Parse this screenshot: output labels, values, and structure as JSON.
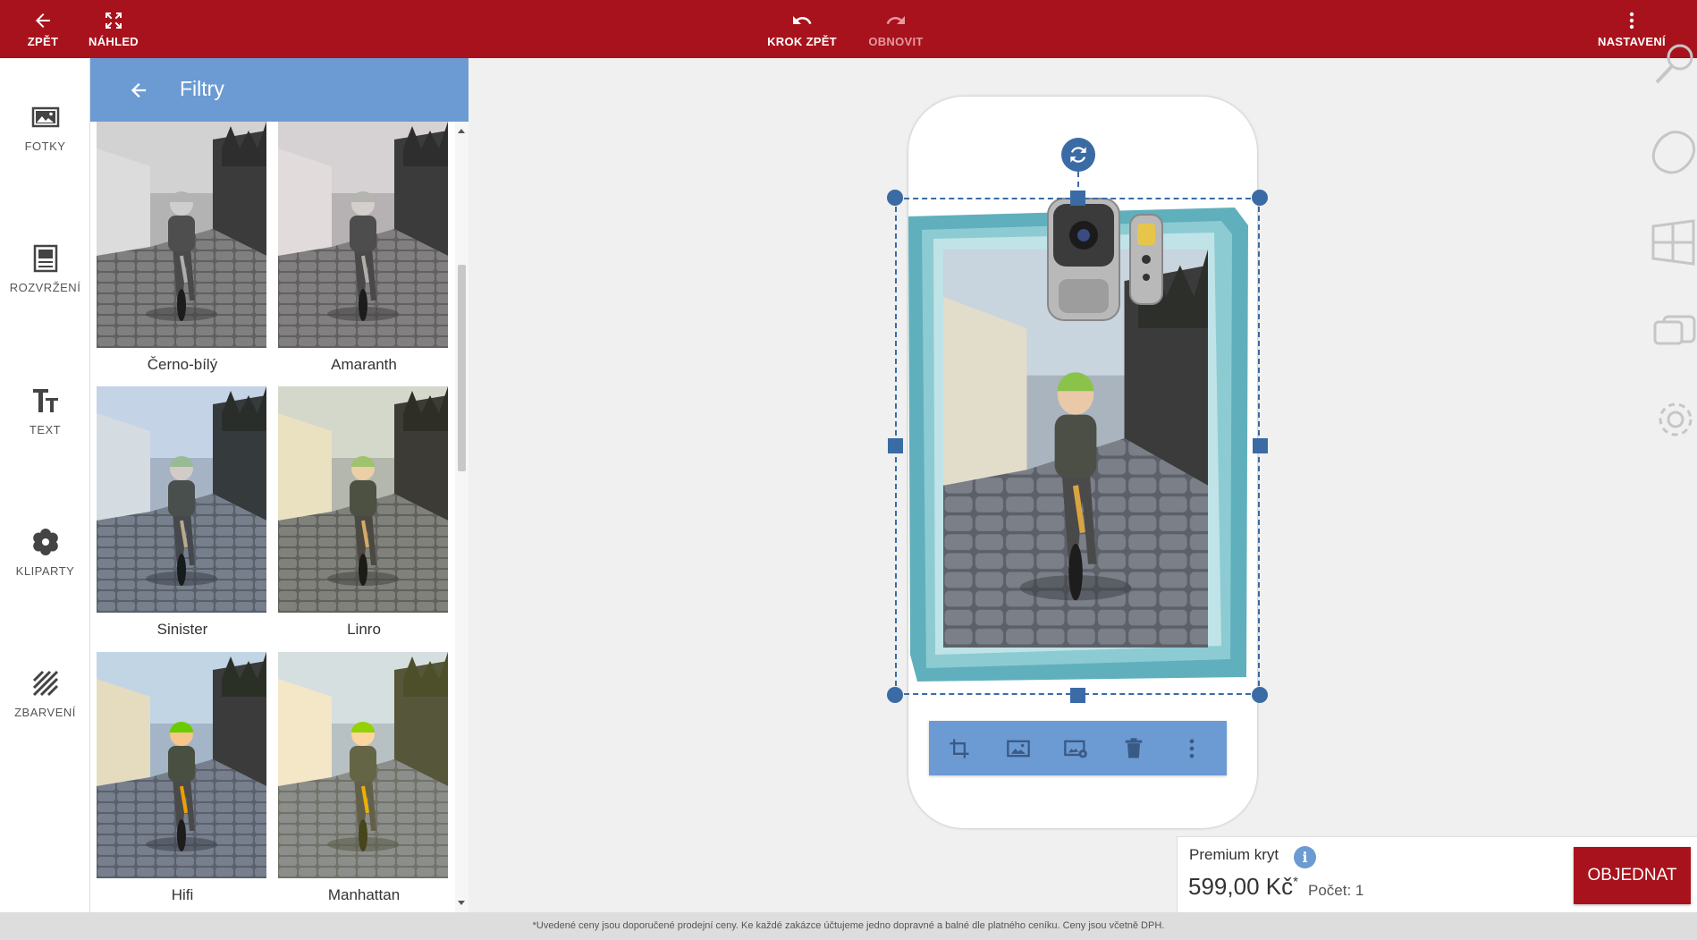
{
  "topbar": {
    "back_label": "ZPĚT",
    "preview_label": "NÁHLED",
    "undo_label": "KROK ZPĚT",
    "redo_label": "OBNOVIT",
    "settings_label": "NASTAVENÍ",
    "color": "#a8121c"
  },
  "leftnav": {
    "items": [
      {
        "label": "FOTKY",
        "icon": "photo-icon"
      },
      {
        "label": "ROZVRŽENÍ",
        "icon": "layout-icon"
      },
      {
        "label": "TEXT",
        "icon": "text-icon"
      },
      {
        "label": "KLIPARTY",
        "icon": "clipart-icon"
      },
      {
        "label": "ZBARVENÍ",
        "icon": "coloring-icon"
      }
    ]
  },
  "panel": {
    "title": "Filtry",
    "header_color": "#6b9bd2",
    "filters": [
      {
        "name": "Černo-bílý"
      },
      {
        "name": "Amaranth"
      },
      {
        "name": "Sinister"
      },
      {
        "name": "Linro"
      },
      {
        "name": "Hifi"
      },
      {
        "name": "Manhattan"
      }
    ]
  },
  "image_toolbar": {
    "tools": [
      "crop-icon",
      "image-icon",
      "image-settings-icon",
      "trash-icon",
      "more-vertical-icon"
    ]
  },
  "right_tools": [
    "zoom-icon",
    "blob-shape-icon",
    "window-icon",
    "card-icon",
    "settings-gear-icon"
  ],
  "order": {
    "product_name": "Premium kryt",
    "price": "599,00 Kč",
    "price_mark": "*",
    "quantity": "Počet: 1",
    "order_label": "OBJEDNAT"
  },
  "footer": {
    "note": "*Uvedené ceny jsou doporučené prodejní ceny. Ke každé zakázce účtujeme jedno dopravné a balné dle platného ceníku. Ceny jsou včetně DPH."
  }
}
